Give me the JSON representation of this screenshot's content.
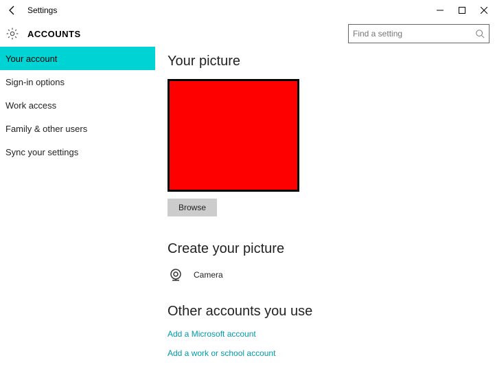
{
  "titlebar": {
    "title": "Settings"
  },
  "header": {
    "title": "ACCOUNTS"
  },
  "search": {
    "placeholder": "Find a setting"
  },
  "sidebar": {
    "items": [
      {
        "label": "Your account"
      },
      {
        "label": "Sign-in options"
      },
      {
        "label": "Work access"
      },
      {
        "label": "Family & other users"
      },
      {
        "label": "Sync your settings"
      }
    ]
  },
  "main": {
    "picture_heading": "Your picture",
    "browse_label": "Browse",
    "create_heading": "Create your picture",
    "camera_label": "Camera",
    "other_heading": "Other accounts you use",
    "link_ms": "Add a Microsoft account",
    "link_work": "Add a work or school account"
  },
  "colors": {
    "accent": "#00d3d3",
    "link": "#0099aa",
    "picture_fill": "#f00"
  }
}
